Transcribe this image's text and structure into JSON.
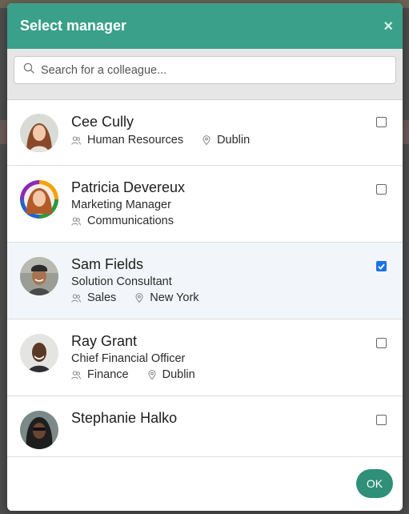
{
  "modal": {
    "title": "Select manager",
    "close_label": "×",
    "accent_color": "#3aa08a",
    "ok_label": "OK"
  },
  "search": {
    "placeholder": "Search for a colleague..."
  },
  "people": [
    {
      "name": "Cee Cully",
      "title": "",
      "department": "Human Resources",
      "location": "Dublin",
      "selected": false
    },
    {
      "name": "Patricia Devereux",
      "title": "Marketing Manager",
      "department": "Communications",
      "location": "",
      "selected": false
    },
    {
      "name": "Sam Fields",
      "title": "Solution Consultant",
      "department": "Sales",
      "location": "New York",
      "selected": true
    },
    {
      "name": "Ray Grant",
      "title": "Chief Financial Officer",
      "department": "Finance",
      "location": "Dublin",
      "selected": false
    },
    {
      "name": "Stephanie Halko",
      "title": "",
      "department": "",
      "location": "",
      "selected": false
    }
  ]
}
